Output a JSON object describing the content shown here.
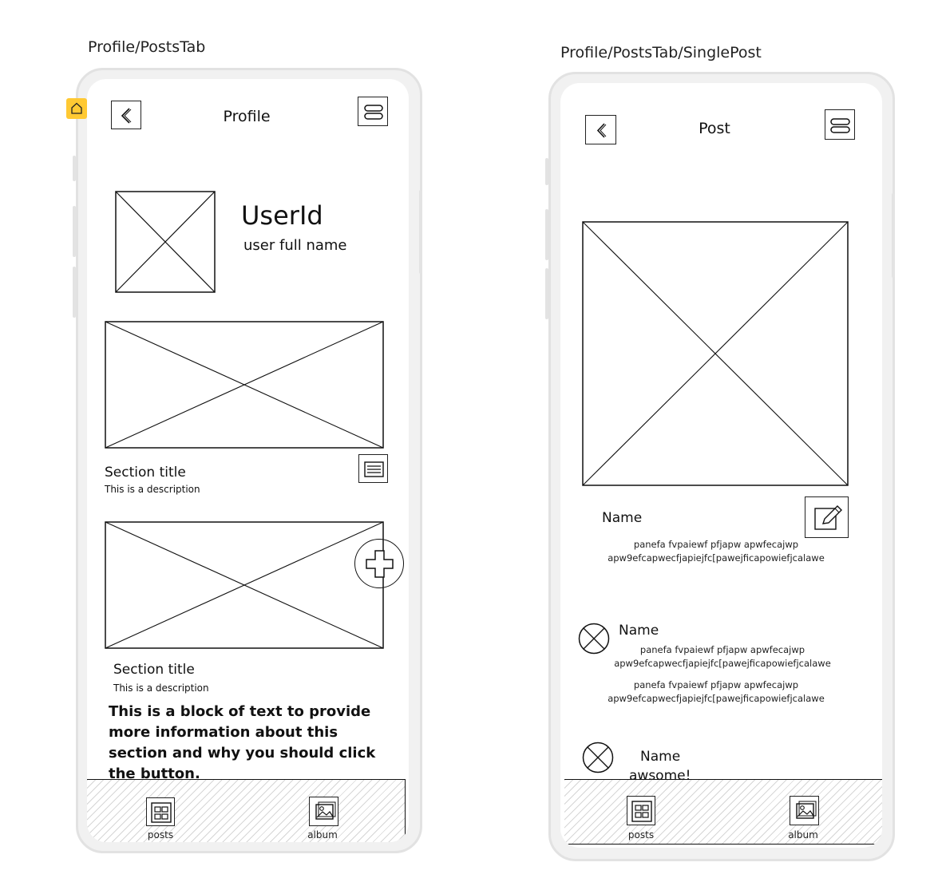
{
  "frames": {
    "left_label": "Profile/PostsTab",
    "right_label": "Profile/PostsTab/SinglePost"
  },
  "profile": {
    "header_title": "Profile",
    "user_id": "UserId",
    "user_full_name": "user full name",
    "section1": {
      "title": "Section title",
      "description": "This is a description"
    },
    "section2": {
      "title": "Section title",
      "description": "This is a description"
    },
    "text_block": "This is a block of text to provide more information about this section and why you should click the button.",
    "nav": {
      "posts": "posts",
      "album": "album"
    }
  },
  "post": {
    "header_title": "Post",
    "name": "Name",
    "caption": "panefa fvpaiewf pfjapw apwfecajwp apw9efcapwecfjapiejfc[pawejficapowiefjcalawe",
    "comments": [
      {
        "name": "Name",
        "lines": [
          "panefa fvpaiewf pfjapw apwfecajwp apw9efcapwecfjapiejfc[pawejficapowiefjcalawe",
          "panefa fvpaiewf pfjapw apwfecajwp apw9efcapwecfjapiejfc[pawejficapowiefjcalawe"
        ]
      },
      {
        "name": "Name",
        "lines": [
          "awsome!"
        ]
      }
    ],
    "nav": {
      "posts": "posts",
      "album": "album"
    }
  },
  "colors": {
    "accent_home": "#ffc933",
    "phone_border": "#e2e2e2",
    "hatch": "#d6d6d6"
  },
  "icons": [
    "home-icon",
    "back-icon",
    "menu-icon",
    "list-icon",
    "plus-icon",
    "edit-icon",
    "grid-icon",
    "image-icon",
    "avatar-placeholder-icon"
  ]
}
